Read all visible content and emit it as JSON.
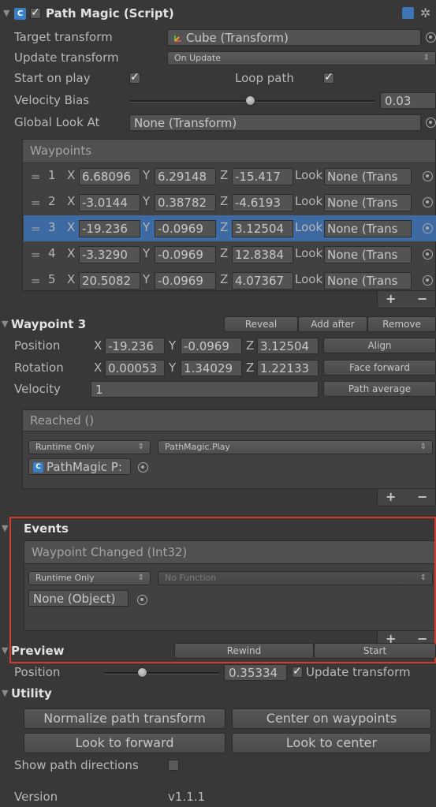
{
  "component": {
    "title": "Path Magic (Script)",
    "enabled": true,
    "target_transform_label": "Target transform",
    "target_transform_value": "Cube (Transform)",
    "update_transform_label": "Update transform",
    "update_transform_value": "On Update",
    "start_on_play_label": "Start on play",
    "start_on_play": true,
    "loop_path_label": "Loop path",
    "loop_path": true,
    "velocity_bias_label": "Velocity Bias",
    "velocity_bias_value": "0.03",
    "velocity_bias_fraction": 0.49,
    "global_look_at_label": "Global Look At",
    "global_look_at_value": "None (Transform)"
  },
  "waypoints": {
    "header": "Waypoints",
    "axis_x": "X",
    "axis_y": "Y",
    "axis_z": "Z",
    "look_label": "Look",
    "grip": "=",
    "rows": [
      {
        "index": "1",
        "x": "6.68096",
        "y": "6.29148",
        "z": "-15.417",
        "look": "None (Trans"
      },
      {
        "index": "2",
        "x": "-3.0144",
        "y": "0.38782",
        "z": "-4.6193",
        "look": "None (Trans"
      },
      {
        "index": "3",
        "x": "-19.236",
        "y": "-0.0969",
        "z": "3.12504",
        "look": "None (Trans"
      },
      {
        "index": "4",
        "x": "-3.3290",
        "y": "-0.0969",
        "z": "12.8384",
        "look": "None (Trans"
      },
      {
        "index": "5",
        "x": "20.5082",
        "y": "-0.0969",
        "z": "4.07367",
        "look": "None (Trans"
      }
    ],
    "selected_index": 2
  },
  "selected_waypoint": {
    "title": "Waypoint 3",
    "reveal_label": "Reveal",
    "add_after_label": "Add after",
    "remove_label": "Remove",
    "position_label": "Position",
    "position_x": "-19.236",
    "position_y": "-0.0969",
    "position_z": "3.12504",
    "align_label": "Align",
    "rotation_label": "Rotation",
    "rotation_x": "0.00053",
    "rotation_y": "1.34029",
    "rotation_z": "1.22133",
    "face_forward_label": "Face forward",
    "velocity_label": "Velocity",
    "velocity_value": "1",
    "path_average_label": "Path average",
    "reached_header": "Reached ()",
    "reached_runtime": "Runtime Only",
    "reached_function": "PathMagic.Play",
    "reached_object": "PathMagic P:"
  },
  "events": {
    "title": "Events",
    "waypoint_changed_header": "Waypoint Changed (Int32)",
    "runtime": "Runtime Only",
    "function": "No Function",
    "object": "None (Object)"
  },
  "preview": {
    "title": "Preview",
    "rewind_label": "Rewind",
    "start_label": "Start",
    "position_label": "Position",
    "position_value": "0.35334",
    "position_fraction": 0.33,
    "update_transform_label": "Update transform",
    "update_transform": true
  },
  "utility": {
    "title": "Utility",
    "normalize_label": "Normalize path transform",
    "center_label": "Center on waypoints",
    "look_forward_label": "Look to forward",
    "look_center_label": "Look to center",
    "show_dirs_label": "Show path directions",
    "show_dirs": false
  },
  "version": {
    "label": "Version",
    "value": "v1.1.1"
  },
  "list_controls": {
    "plus": "+",
    "minus": "−"
  },
  "colors": {
    "selection": "#3d6aa2",
    "highlight_frame": "#d23b2e",
    "background": "#383838"
  }
}
